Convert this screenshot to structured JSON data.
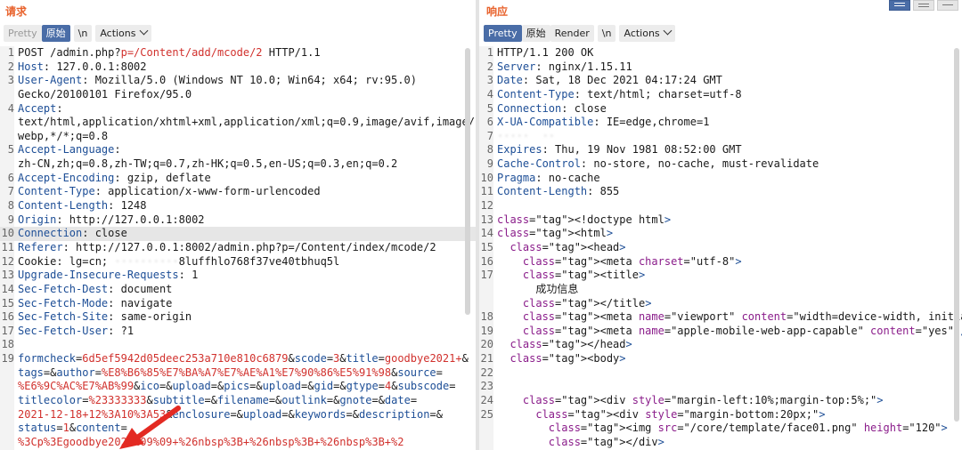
{
  "request": {
    "title": "请求",
    "tabs": [
      "Pretty",
      "原始",
      "\\n"
    ],
    "actions_label": "Actions",
    "lines": [
      {
        "n": "1",
        "code": "POST /admin.php?p=/Content/add/mcode/2 HTTP/1.1"
      },
      {
        "n": "2",
        "code": "Host: 127.0.0.1:8002"
      },
      {
        "n": "3",
        "code": "User-Agent: Mozilla/5.0 (Windows NT 10.0; Win64; x64; rv:95.0)"
      },
      {
        "n": "",
        "code": "Gecko/20100101 Firefox/95.0"
      },
      {
        "n": "4",
        "code": "Accept:"
      },
      {
        "n": "",
        "code": "text/html,application/xhtml+xml,application/xml;q=0.9,image/avif,image/"
      },
      {
        "n": "",
        "code": "webp,*/*;q=0.8"
      },
      {
        "n": "5",
        "code": "Accept-Language:"
      },
      {
        "n": "",
        "code": "zh-CN,zh;q=0.8,zh-TW;q=0.7,zh-HK;q=0.5,en-US;q=0.3,en;q=0.2"
      },
      {
        "n": "6",
        "code": "Accept-Encoding: gzip, deflate"
      },
      {
        "n": "7",
        "code": "Content-Type: application/x-www-form-urlencoded"
      },
      {
        "n": "8",
        "code": "Content-Length: 1248"
      },
      {
        "n": "9",
        "code": "Origin: http://127.0.0.1:8002"
      },
      {
        "n": "10",
        "code": "Connection: close"
      },
      {
        "n": "11",
        "code": "Referer: http://127.0.0.1:8002/admin.php?p=/Content/index/mcode/2"
      },
      {
        "n": "12",
        "code": "Cookie: lg=cn; ··········8luffhlo768f37ve40tbhuq5l"
      },
      {
        "n": "13",
        "code": "Upgrade-Insecure-Requests: 1"
      },
      {
        "n": "14",
        "code": "Sec-Fetch-Dest: document"
      },
      {
        "n": "15",
        "code": "Sec-Fetch-Mode: navigate"
      },
      {
        "n": "16",
        "code": "Sec-Fetch-Site: same-origin"
      },
      {
        "n": "17",
        "code": "Sec-Fetch-User: ?1"
      },
      {
        "n": "18",
        "code": ""
      },
      {
        "n": "19",
        "code": "formcheck=6d5ef5942d05deec253a710e810c6879&scode=3&title=goodbye2021+&"
      },
      {
        "n": "",
        "code": "tags=&author=%E8%B6%85%E7%BA%A7%E7%AE%A1%E7%90%86%E5%91%98&source="
      },
      {
        "n": "",
        "code": "%E6%9C%AC%E7%AB%99&ico=&upload=&pics=&upload=&gid=&gtype=4&subscode="
      },
      {
        "n": "",
        "code": "titlecolor=%23333333&subtitle=&filename=&outlink=&gnote=&date="
      },
      {
        "n": "",
        "code": "2021-12-18+12%3A10%3A53&enclosure=&upload=&keywords=&description=&"
      },
      {
        "n": "",
        "code": "status=1&content="
      },
      {
        "n": "",
        "code": "%3Cp%3Egoodbye2021%09%09+%26nbsp%3B+%26nbsp%3B+%26nbsp%3B+%2"
      }
    ]
  },
  "response": {
    "title": "响应",
    "tabs": [
      "Pretty",
      "原始",
      "Render",
      "\\n"
    ],
    "actions_label": "Actions",
    "lines": [
      {
        "n": "1",
        "code": "HTTP/1.1 200 OK"
      },
      {
        "n": "2",
        "code": "Server: nginx/1.15.11"
      },
      {
        "n": "3",
        "code": "Date: Sat, 18 Dec 2021 04:17:24 GMT"
      },
      {
        "n": "4",
        "code": "Content-Type: text/html; charset=utf-8"
      },
      {
        "n": "5",
        "code": "Connection: close"
      },
      {
        "n": "6",
        "code": "X-UA-Compatible: IE=edge,chrome=1"
      },
      {
        "n": "7",
        "code": "·····  ··"
      },
      {
        "n": "8",
        "code": "Expires: Thu, 19 Nov 1981 08:52:00 GMT"
      },
      {
        "n": "9",
        "code": "Cache-Control: no-store, no-cache, must-revalidate"
      },
      {
        "n": "10",
        "code": "Pragma: no-cache"
      },
      {
        "n": "11",
        "code": "Content-Length: 855"
      },
      {
        "n": "12",
        "code": ""
      },
      {
        "n": "13",
        "code": "<!doctype html>"
      },
      {
        "n": "14",
        "code": "<html>"
      },
      {
        "n": "15",
        "code": "  <head>"
      },
      {
        "n": "16",
        "code": "    <meta charset=\"utf-8\">"
      },
      {
        "n": "17",
        "code": "    <title>"
      },
      {
        "n": "",
        "code": "      成功信息"
      },
      {
        "n": "",
        "code": "    </title>"
      },
      {
        "n": "18",
        "code": "    <meta name=\"viewport\" content=\"width=device-width, initial-scale=1.0,"
      },
      {
        "n": "19",
        "code": "    <meta name=\"apple-mobile-web-app-capable\" content=\"yes\" />"
      },
      {
        "n": "20",
        "code": "  </head>"
      },
      {
        "n": "21",
        "code": "  <body>"
      },
      {
        "n": "22",
        "code": ""
      },
      {
        "n": "23",
        "code": ""
      },
      {
        "n": "24",
        "code": "    <div style=\"margin-left:10%;margin-top:5%;\">"
      },
      {
        "n": "25",
        "code": "      <div style=\"margin-bottom:20px;\">"
      },
      {
        "n": "",
        "code": "        <img src=\"/core/template/face01.png\" height=\"120\">"
      },
      {
        "n": "",
        "code": "        </div>"
      }
    ]
  },
  "icons": {
    "view_buttons": [
      "split-horizontal-icon",
      "split-vertical-icon",
      "single-pane-icon"
    ],
    "annotation": "red-arrow-icon"
  },
  "colors": {
    "accent": "#e8622c",
    "active_tab": "#4a6da7",
    "key": "#1d4e96",
    "param": "#d1312d",
    "arrow": "#e32a22"
  }
}
